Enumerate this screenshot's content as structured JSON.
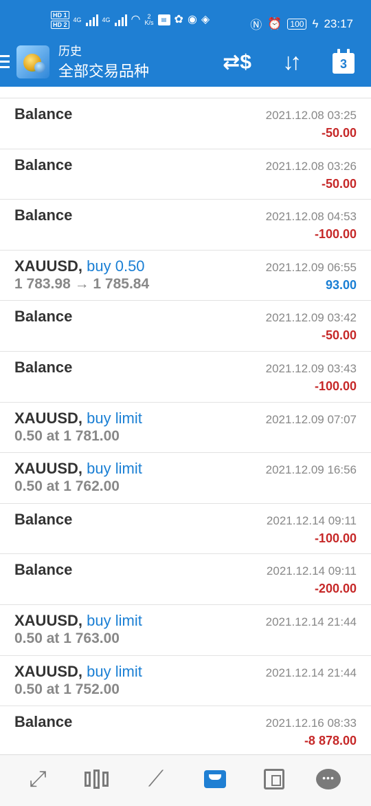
{
  "status_bar": {
    "sim1": "HD 1",
    "sim2": "HD 2",
    "net1": "4G",
    "net2": "4G",
    "speed_value": "2",
    "speed_unit": "K/s",
    "battery": "100",
    "time": "23:17"
  },
  "app_bar": {
    "title": "历史",
    "subtitle": "全部交易品种"
  },
  "calendar_day": "3",
  "history": [
    {
      "symbol": "Balance",
      "type": "",
      "detail": "",
      "time": "2021.12.08 03:25",
      "amount": "-50.00",
      "sign": "neg"
    },
    {
      "symbol": "Balance",
      "type": "",
      "detail": "",
      "time": "2021.12.08 03:26",
      "amount": "-50.00",
      "sign": "neg"
    },
    {
      "symbol": "Balance",
      "type": "",
      "detail": "",
      "time": "2021.12.08 04:53",
      "amount": "-100.00",
      "sign": "neg"
    },
    {
      "symbol": "XAUUSD,",
      "type": "buy 0.50",
      "detail": "1 783.98 → 1 785.84",
      "time": "2021.12.09 06:55",
      "amount": "93.00",
      "sign": "pos"
    },
    {
      "symbol": "Balance",
      "type": "",
      "detail": "",
      "time": "2021.12.09 03:42",
      "amount": "-50.00",
      "sign": "neg"
    },
    {
      "symbol": "Balance",
      "type": "",
      "detail": "",
      "time": "2021.12.09 03:43",
      "amount": "-100.00",
      "sign": "neg"
    },
    {
      "symbol": "XAUUSD,",
      "type": "buy limit",
      "detail": "0.50 at 1 781.00",
      "time": "2021.12.09 07:07",
      "amount": "",
      "sign": "none"
    },
    {
      "symbol": "XAUUSD,",
      "type": "buy limit",
      "detail": "0.50 at 1 762.00",
      "time": "2021.12.09 16:56",
      "amount": "",
      "sign": "none"
    },
    {
      "symbol": "Balance",
      "type": "",
      "detail": "",
      "time": "2021.12.14 09:11",
      "amount": "-100.00",
      "sign": "neg"
    },
    {
      "symbol": "Balance",
      "type": "",
      "detail": "",
      "time": "2021.12.14 09:11",
      "amount": "-200.00",
      "sign": "neg"
    },
    {
      "symbol": "XAUUSD,",
      "type": "buy limit",
      "detail": "0.50 at 1 763.00",
      "time": "2021.12.14 21:44",
      "amount": "",
      "sign": "none"
    },
    {
      "symbol": "XAUUSD,",
      "type": "buy limit",
      "detail": "0.50 at 1 752.00",
      "time": "2021.12.14 21:44",
      "amount": "",
      "sign": "none"
    },
    {
      "symbol": "Balance",
      "type": "",
      "detail": "",
      "time": "2021.12.16 08:33",
      "amount": "-8 878.00",
      "sign": "neg"
    }
  ],
  "bottom_nav": {
    "active": "history",
    "icons": [
      "quotes-icon",
      "chart-icon",
      "trade-icon",
      "history-icon",
      "news-icon",
      "chat-icon"
    ]
  }
}
